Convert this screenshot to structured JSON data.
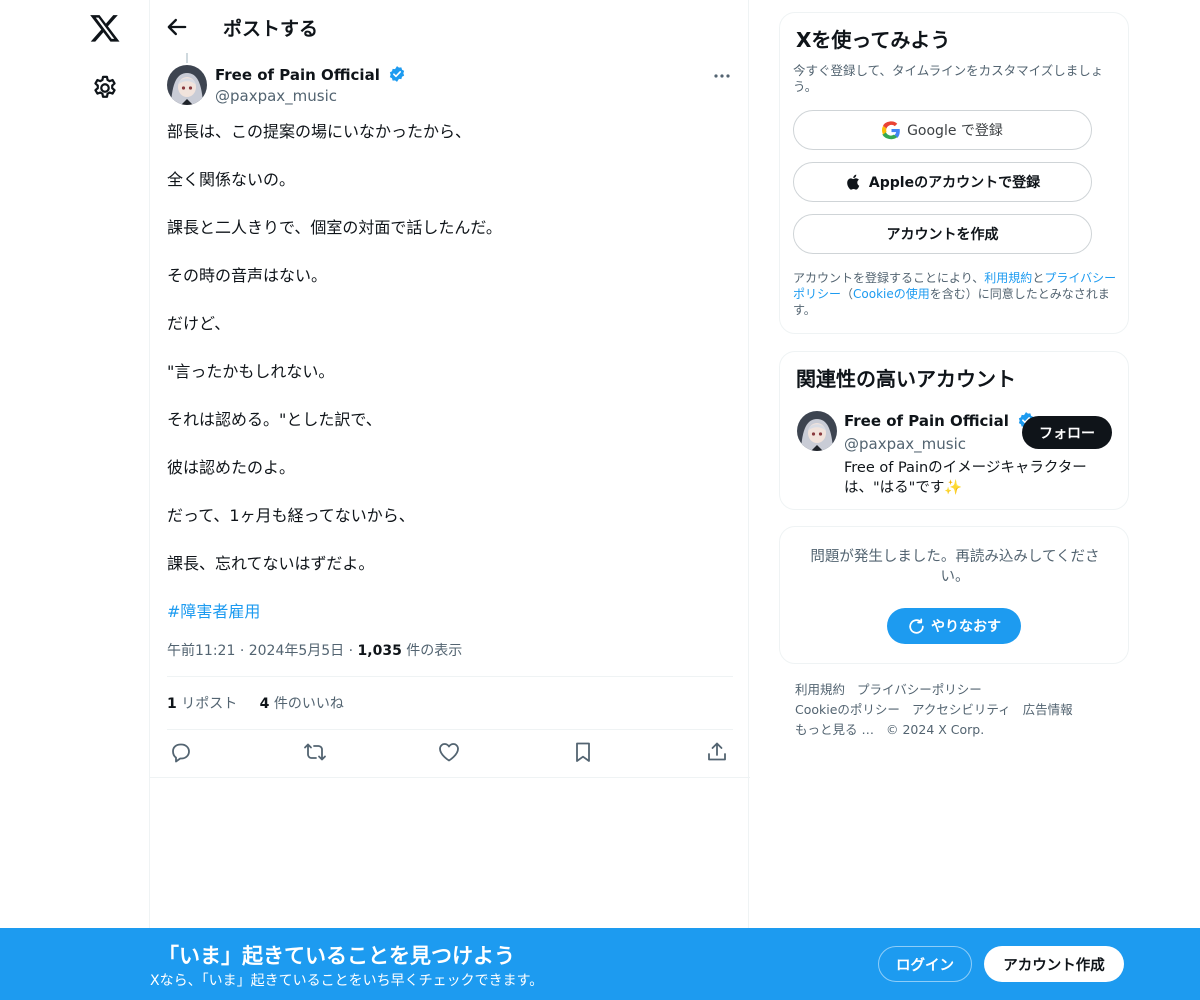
{
  "nav": {
    "logo_icon": "x-logo-icon",
    "settings_icon": "gear-icon"
  },
  "header": {
    "back_icon": "arrow-left-icon",
    "title": "ポストする"
  },
  "post": {
    "author_name": "Free of Pain Official",
    "author_handle": "@paxpax_music",
    "verified": true,
    "lines": [
      "部長は、この提案の場にいなかったから、",
      "全く関係ないの。",
      "課長と二人きりで、個室の対面で話したんだ。",
      "その時の音声はない。",
      "だけど、",
      "\"言ったかもしれない。",
      "それは認める。\"とした訳で、",
      "彼は認めたのよ。",
      "だって、1ヶ月も経ってないから、",
      "課長、忘れてないはずだよ。"
    ],
    "hashtag": "#障害者雇用",
    "time": "午前11:21",
    "sep1": "·",
    "date": "2024年5月5日",
    "sep2": "·",
    "views_count": "1,035",
    "views_label": "件の表示",
    "reposts_count": "1",
    "reposts_label": "リポスト",
    "likes_count": "4",
    "likes_label": "件のいいね"
  },
  "signup_card": {
    "title": "Xを使ってみよう",
    "subtitle": "今すぐ登録して、タイムラインをカスタマイズしましょう。",
    "google_label": "Google で登録",
    "apple_label": "Appleのアカウントで登録",
    "create_label": "アカウントを作成",
    "legal_1": "アカウントを登録することにより、",
    "legal_terms": "利用規約",
    "legal_and": "と",
    "legal_privacy": "プライバシーポリシー",
    "legal_2": "（",
    "legal_cookie": "Cookieの使用",
    "legal_3": "を含む）に同意したとみなされます。"
  },
  "related": {
    "title": "関連性の高いアカウント",
    "name": "Free of Pain Official",
    "handle": "@paxpax_music",
    "bio": "Free of Painのイメージキャラクターは、\"はる\"です✨",
    "follow_label": "フォロー"
  },
  "error_card": {
    "message": "問題が発生しました。再読み込みしてください。",
    "retry_label": "やりなおす"
  },
  "footer": {
    "links": [
      "利用規約",
      "プライバシーポリシー",
      "Cookieのポリシー",
      "アクセシビリティ",
      "広告情報",
      "もっと見る …",
      "© 2024 X Corp."
    ]
  },
  "banner": {
    "title": "「いま」起きていることを見つけよう",
    "subtitle": "Xなら、「いま」起きていることをいち早くチェックできます。",
    "login_label": "ログイン",
    "signup_label": "アカウント作成"
  },
  "colors": {
    "accent": "#1d9bf0",
    "text": "#0f1419",
    "muted": "#536471",
    "border": "#eff3f4"
  }
}
